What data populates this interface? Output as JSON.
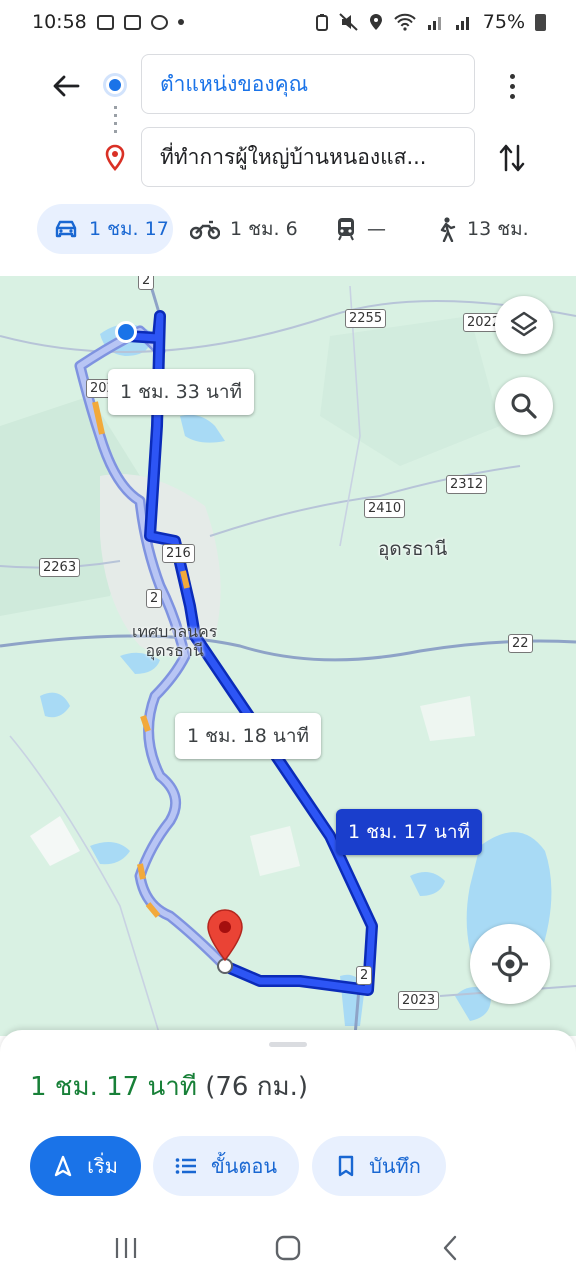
{
  "status_bar": {
    "time": "10:58",
    "battery": "75%"
  },
  "directions": {
    "origin": "ตำแหน่งของคุณ",
    "destination": "ที่ทำการผู้ใหญ่บ้านหนองแส..."
  },
  "travel_modes": [
    {
      "mode": "car",
      "label": "1 ชม. 17",
      "selected": true
    },
    {
      "mode": "motorcycle",
      "label": "1 ชม. 6"
    },
    {
      "mode": "transit",
      "label": "—"
    },
    {
      "mode": "walk",
      "label": "13 ชม."
    }
  ],
  "map": {
    "road_shields": [
      "2",
      "2255",
      "2022",
      "2312",
      "2410",
      "216",
      "2263",
      "2",
      "22",
      "2",
      "2023",
      "202"
    ],
    "place_labels": {
      "region": "อุดรธานี",
      "city_line1": "เทศบาลนคร",
      "city_line2": "อุดรธานี"
    },
    "route_times": {
      "alt1": "1 ชม. 33 นาที",
      "alt2": "1 ชม. 18 นาที",
      "main": "1 ชม. 17 นาที"
    },
    "colors": {
      "land": "#d9f1e3",
      "water": "#a8daf5",
      "route_main": "#1a3ecc",
      "route_alt": "#aab8f0"
    }
  },
  "summary": {
    "duration": "1 ชม. 17 นาที",
    "distance": "(76 กม.)"
  },
  "actions": {
    "start": "เริ่ม",
    "steps": "ขั้นตอน",
    "save": "บันทึก"
  },
  "icons": [
    "back-arrow-icon",
    "more-vert-icon",
    "swap-icon",
    "car-icon",
    "motorcycle-icon",
    "train-icon",
    "walk-icon",
    "layers-icon",
    "search-icon",
    "my-location-icon",
    "navigation-icon",
    "list-icon",
    "bookmark-icon"
  ]
}
